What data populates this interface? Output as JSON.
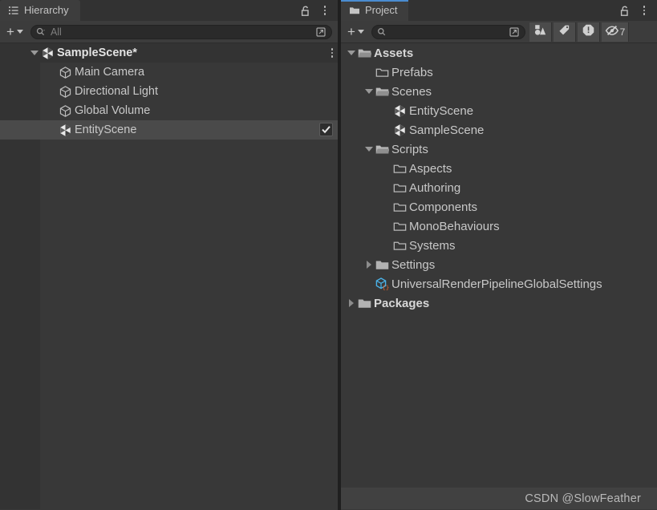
{
  "theme": {
    "window_bg": "#383838",
    "tabbar_bg": "#323232",
    "tab_active_bg": "#3d3d3d",
    "toolbar_bg": "#3c3c3c",
    "accent": "#4a8cd0",
    "text": "#c8c8c8",
    "selection_bg": "#4a4a4a",
    "gutter_bg": "#333333",
    "divider": "#1f1f1f",
    "watermark_bg": "#414141"
  },
  "hierarchy": {
    "tab": {
      "label": "Hierarchy",
      "icon": "hierarchy-list-icon"
    },
    "tab_controls": {
      "lock": "lock-open-icon",
      "menu": "kebab-menu-icon"
    },
    "toolbar": {
      "add_label": "+",
      "add_dropdown": "chevron-down-icon",
      "search_placeholder": "All",
      "search_value": "",
      "search_icon": "search-icon",
      "expand_icon": "open-in-new-icon"
    },
    "rows": [
      {
        "label": "SampleScene*",
        "icon": "unity-scene-icon",
        "indent": 1,
        "twisty": "down",
        "bold": true,
        "selected": false,
        "kebab": true,
        "checkbox": false
      },
      {
        "label": "Main Camera",
        "icon": "gameobject-cube-icon",
        "indent": 2,
        "twisty": "none",
        "bold": false,
        "selected": false,
        "kebab": false,
        "checkbox": false
      },
      {
        "label": "Directional Light",
        "icon": "gameobject-cube-icon",
        "indent": 2,
        "twisty": "none",
        "bold": false,
        "selected": false,
        "kebab": false,
        "checkbox": false
      },
      {
        "label": "Global Volume",
        "icon": "gameobject-cube-icon",
        "indent": 2,
        "twisty": "none",
        "bold": false,
        "selected": false,
        "kebab": false,
        "checkbox": false
      },
      {
        "label": "EntityScene",
        "icon": "unity-scene-icon",
        "indent": 2,
        "twisty": "none",
        "bold": false,
        "selected": true,
        "kebab": false,
        "checkbox": true
      }
    ]
  },
  "project": {
    "tab": {
      "label": "Project",
      "icon": "folder-icon"
    },
    "tab_controls": {
      "lock": "lock-open-icon",
      "menu": "kebab-menu-icon"
    },
    "toolbar": {
      "add_label": "+",
      "add_dropdown": "chevron-down-icon",
      "search_placeholder": "",
      "search_value": "",
      "search_icon": "search-icon",
      "expand_icon": "open-in-new-icon",
      "filter_type_icon": "shapes-filter-icon",
      "filter_label_icon": "tag-filter-icon",
      "warning_icon": "exclamation-octagon-icon",
      "hidden_icon": "eye-off-icon",
      "hidden_count": "7"
    },
    "rows": [
      {
        "label": "Assets",
        "icon": "folder-open-icon",
        "indent": 0,
        "twisty": "down",
        "bold": true
      },
      {
        "label": "Prefabs",
        "icon": "folder-outline-icon",
        "indent": 1,
        "twisty": "none",
        "bold": false
      },
      {
        "label": "Scenes",
        "icon": "folder-open-icon",
        "indent": 1,
        "twisty": "down",
        "bold": false
      },
      {
        "label": "EntityScene",
        "icon": "unity-scene-icon",
        "indent": 2,
        "twisty": "none",
        "bold": false
      },
      {
        "label": "SampleScene",
        "icon": "unity-scene-icon",
        "indent": 2,
        "twisty": "none",
        "bold": false
      },
      {
        "label": "Scripts",
        "icon": "folder-open-icon",
        "indent": 1,
        "twisty": "down",
        "bold": false
      },
      {
        "label": "Aspects",
        "icon": "folder-outline-icon",
        "indent": 2,
        "twisty": "none",
        "bold": false
      },
      {
        "label": "Authoring",
        "icon": "folder-outline-icon",
        "indent": 2,
        "twisty": "none",
        "bold": false
      },
      {
        "label": "Components",
        "icon": "folder-outline-icon",
        "indent": 2,
        "twisty": "none",
        "bold": false
      },
      {
        "label": "MonoBehaviours",
        "icon": "folder-outline-icon",
        "indent": 2,
        "twisty": "none",
        "bold": false
      },
      {
        "label": "Systems",
        "icon": "folder-outline-icon",
        "indent": 2,
        "twisty": "none",
        "bold": false
      },
      {
        "label": "Settings",
        "icon": "folder-solid-icon",
        "indent": 1,
        "twisty": "right",
        "bold": false
      },
      {
        "label": "UniversalRenderPipelineGlobalSettings",
        "icon": "scriptable-object-icon",
        "indent": 1,
        "twisty": "none",
        "bold": false
      },
      {
        "label": "Packages",
        "icon": "folder-solid-icon",
        "indent": 0,
        "twisty": "right",
        "bold": true
      }
    ]
  },
  "watermark": {
    "text": "CSDN @SlowFeather"
  }
}
